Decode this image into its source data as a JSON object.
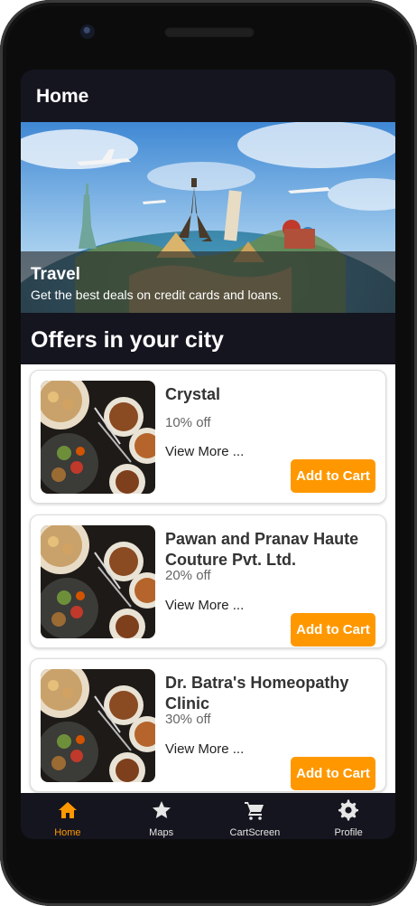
{
  "appbar": {
    "title": "Home"
  },
  "hero": {
    "title": "Travel",
    "subtitle": "Get the best deals on credit cards and loans."
  },
  "section": {
    "title": "Offers in your city"
  },
  "offers": [
    {
      "name": "Crystal",
      "discount": "10% off",
      "more": "View More ...",
      "button": "Add to Cart"
    },
    {
      "name": "Pawan and Pranav Haute Couture Pvt. Ltd.",
      "discount": "20% off",
      "more": "View More ...",
      "button": "Add to Cart"
    },
    {
      "name": "Dr. Batra's Homeopathy Clinic",
      "discount": "30% off",
      "more": "View More ...",
      "button": "Add to Cart"
    }
  ],
  "nav": [
    {
      "label": "Home",
      "icon": "home-icon",
      "active": true
    },
    {
      "label": "Maps",
      "icon": "star-icon",
      "active": false
    },
    {
      "label": "CartScreen",
      "icon": "cart-icon",
      "active": false
    },
    {
      "label": "Profile",
      "icon": "gear-icon",
      "active": false
    }
  ],
  "colors": {
    "accent": "#ff9800",
    "background": "#15151f",
    "card": "#ffffff"
  }
}
